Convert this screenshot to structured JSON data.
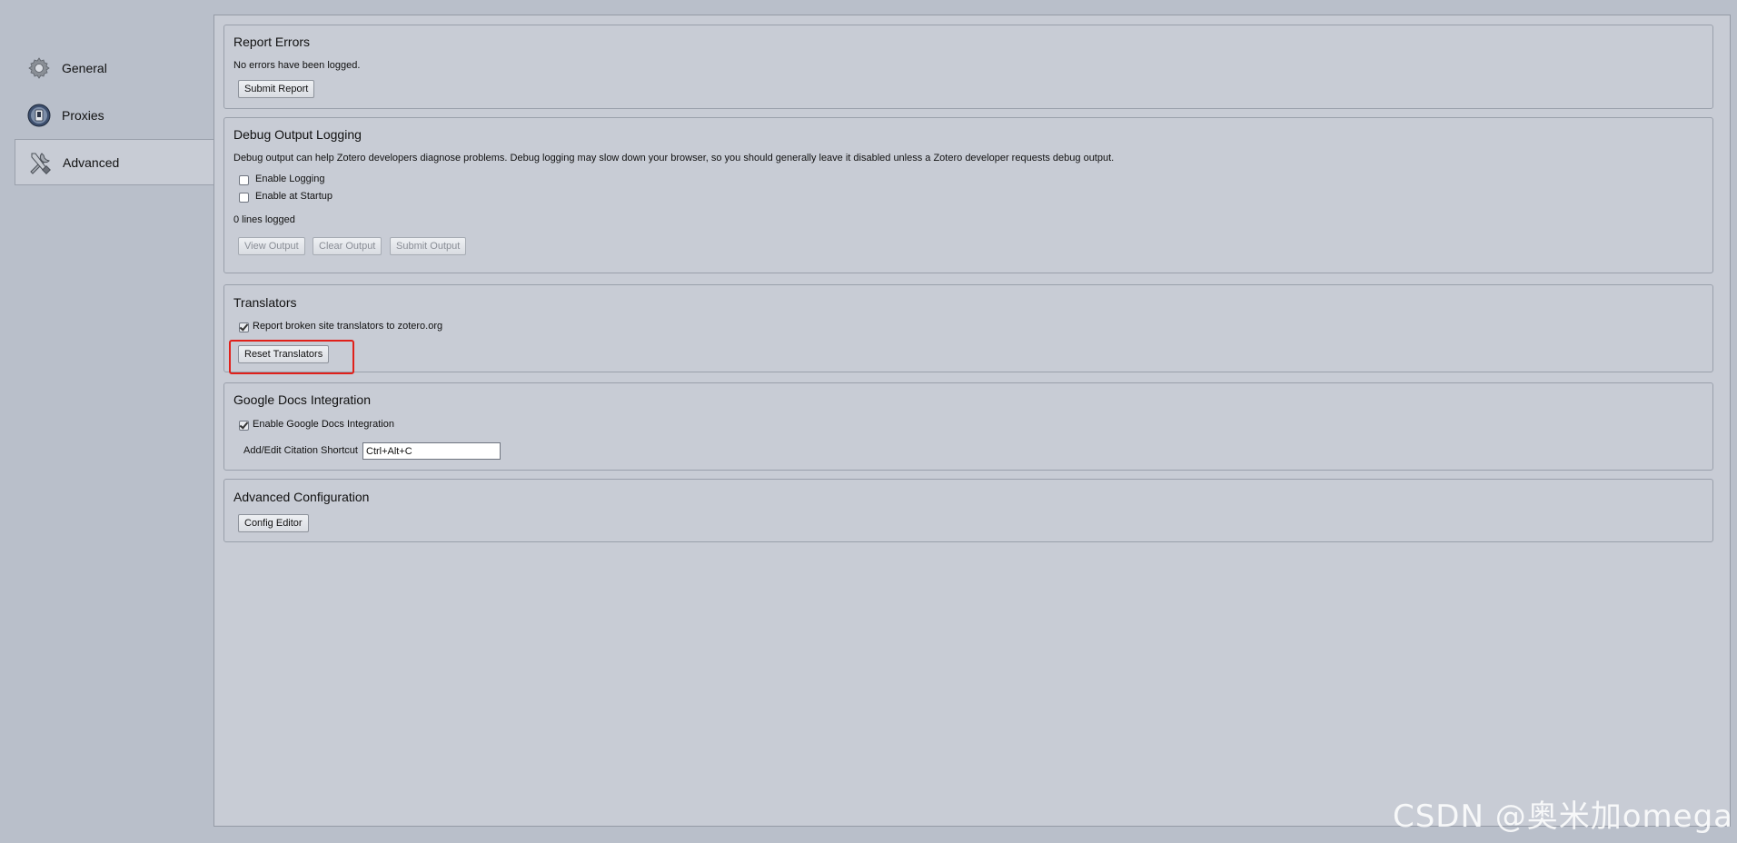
{
  "sidebar": {
    "items": [
      {
        "label": "General",
        "icon": "gear-icon"
      },
      {
        "label": "Proxies",
        "icon": "proxy-icon"
      },
      {
        "label": "Advanced",
        "icon": "tools-icon",
        "selected": true
      }
    ]
  },
  "report_errors": {
    "title": "Report Errors",
    "status": "No errors have been logged.",
    "submit_button": "Submit Report"
  },
  "debug_logging": {
    "title": "Debug Output Logging",
    "description": "Debug output can help Zotero developers diagnose problems. Debug logging may slow down your browser, so you should generally leave it disabled unless a Zotero developer requests debug output.",
    "enable_logging": {
      "label": "Enable Logging",
      "checked": false
    },
    "enable_startup": {
      "label": "Enable at Startup",
      "checked": false
    },
    "lines_logged": "0 lines logged",
    "view_button": "View Output",
    "clear_button": "Clear Output",
    "submit_button": "Submit Output"
  },
  "translators": {
    "title": "Translators",
    "report_broken": {
      "label": "Report broken site translators to zotero.org",
      "checked": true
    },
    "reset_button": "Reset Translators"
  },
  "google_docs": {
    "title": "Google Docs Integration",
    "enable": {
      "label": "Enable Google Docs Integration",
      "checked": true
    },
    "shortcut_label": "Add/Edit Citation Shortcut",
    "shortcut_value": "Ctrl+Alt+C"
  },
  "advanced_config": {
    "title": "Advanced Configuration",
    "config_button": "Config Editor"
  },
  "watermark": "CSDN @奥米加omega",
  "colors": {
    "highlight": "#e0201a",
    "background": "#b9bfca",
    "panel": "#c8ccd5"
  }
}
